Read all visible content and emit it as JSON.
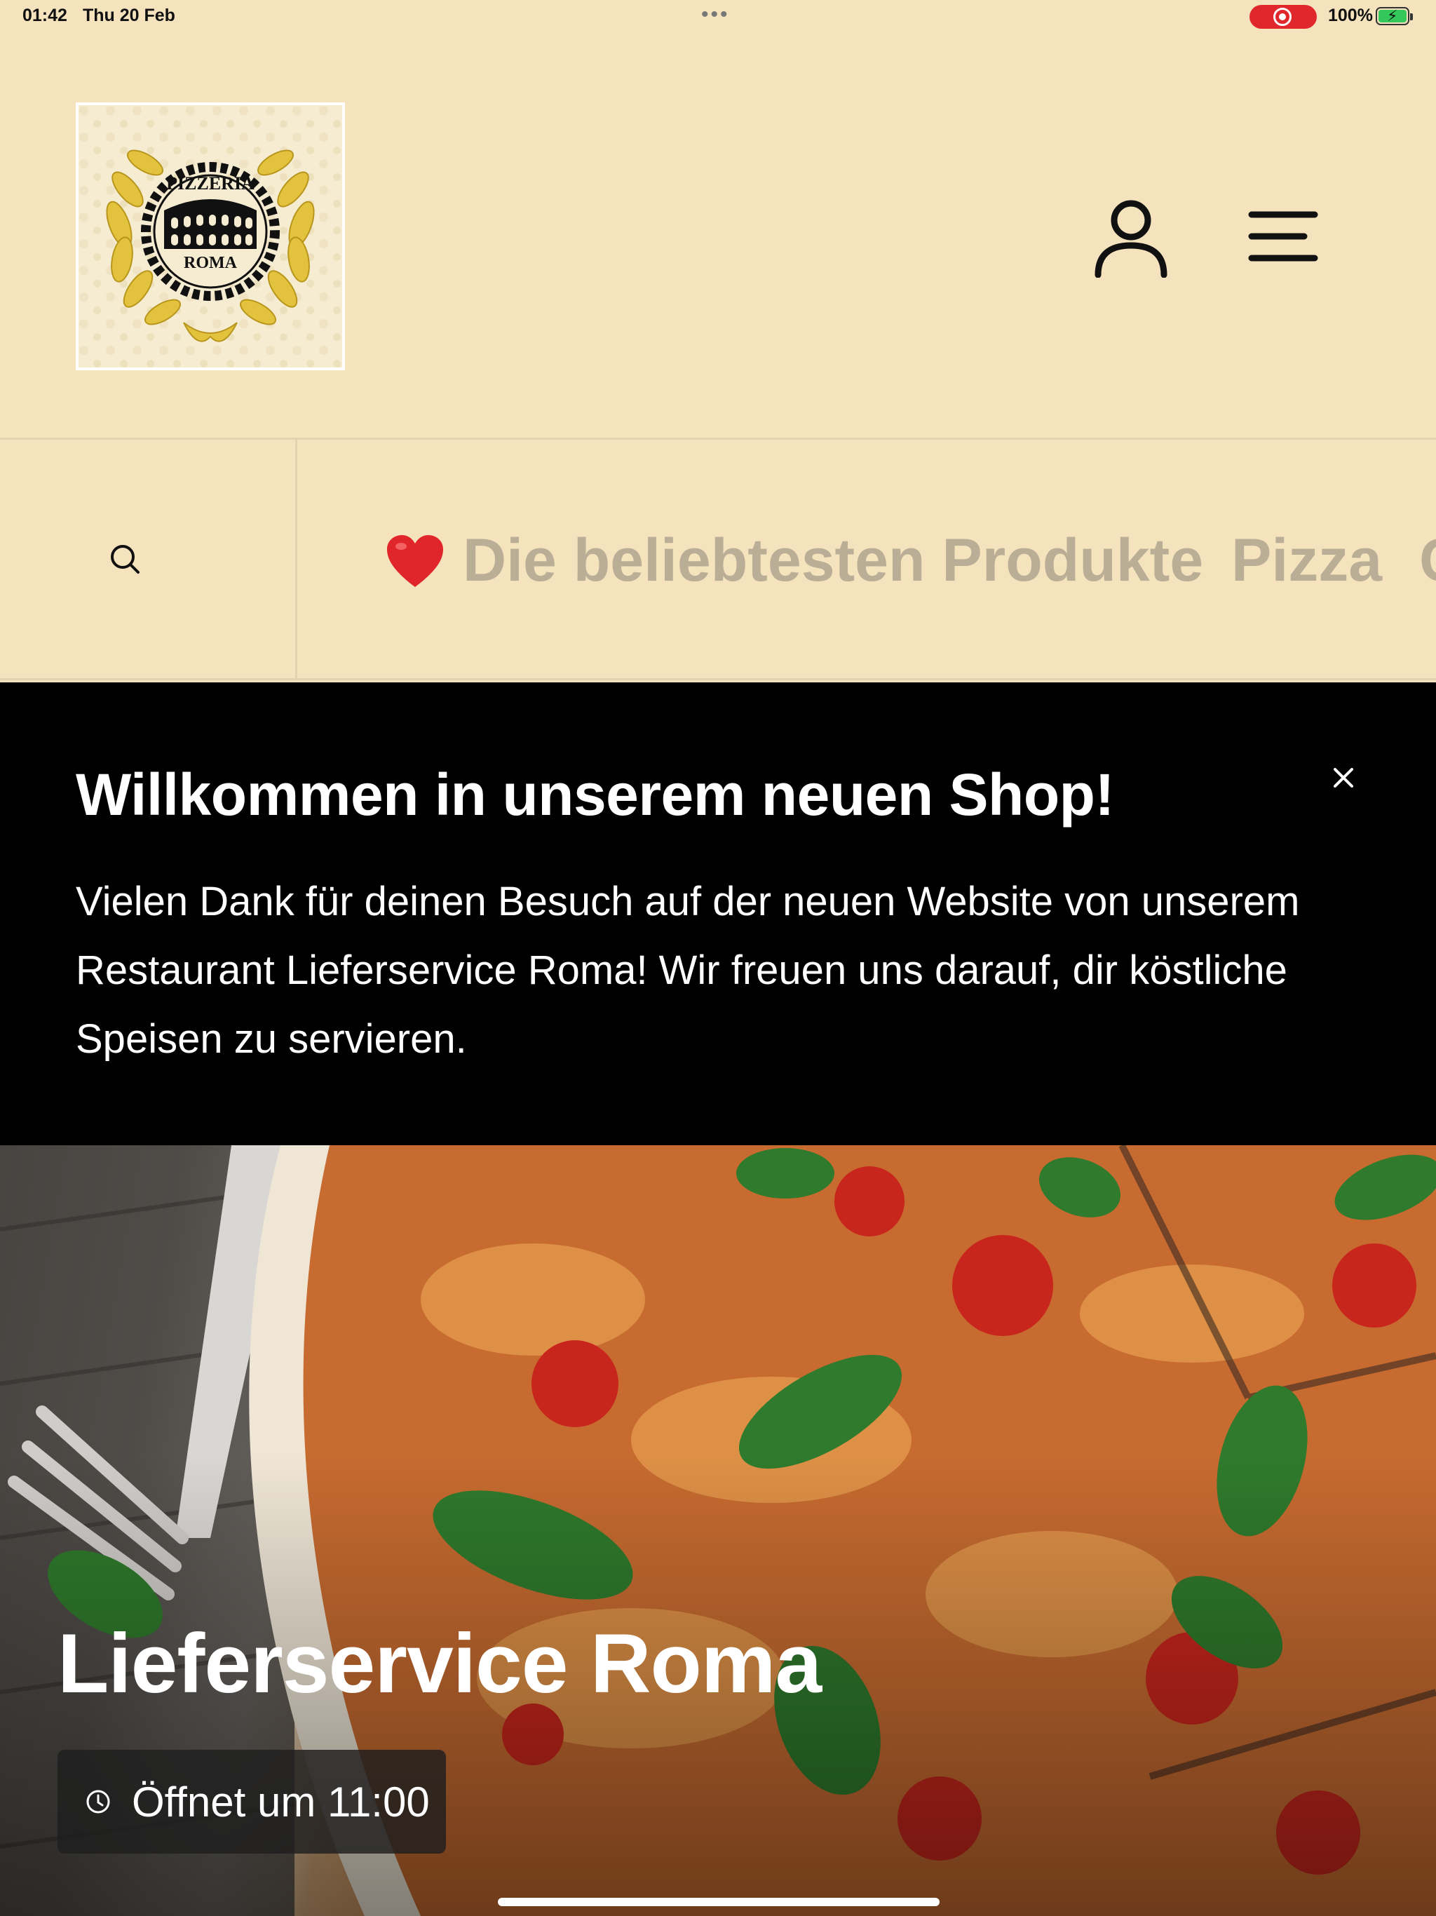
{
  "status_bar": {
    "time": "01:42",
    "date": "Thu 20 Feb",
    "battery": "100%",
    "recording_color": "#e0272c",
    "battery_color": "#34c759"
  },
  "header": {
    "logo": {
      "top_text": "PIZZERIA",
      "bottom_text": "ROMA"
    },
    "account_icon": "user-icon",
    "menu_icon": "hamburger-menu-icon"
  },
  "categories": {
    "search_icon": "search-icon",
    "items": [
      {
        "emoji": "❤️",
        "label": "Die beliebtesten Produkte"
      },
      {
        "label": "Pizza"
      },
      {
        "label": "C"
      }
    ]
  },
  "banner": {
    "title": "Willkommen in unserem neuen Shop!",
    "text": "Vielen Dank für deinen Besuch auf der neuen Website von unserem Restaurant Lieferservice Roma! Wir freuen uns darauf, dir köstliche Speisen zu servieren.",
    "close_icon": "close-icon"
  },
  "hero": {
    "title": "Lieferservice Roma",
    "opening_status": "Öffnet um 11:00",
    "clock_icon": "clock-icon"
  },
  "colors": {
    "page_background": "#f4e3bd",
    "category_text": "#bbae96",
    "banner_background": "#000000"
  }
}
